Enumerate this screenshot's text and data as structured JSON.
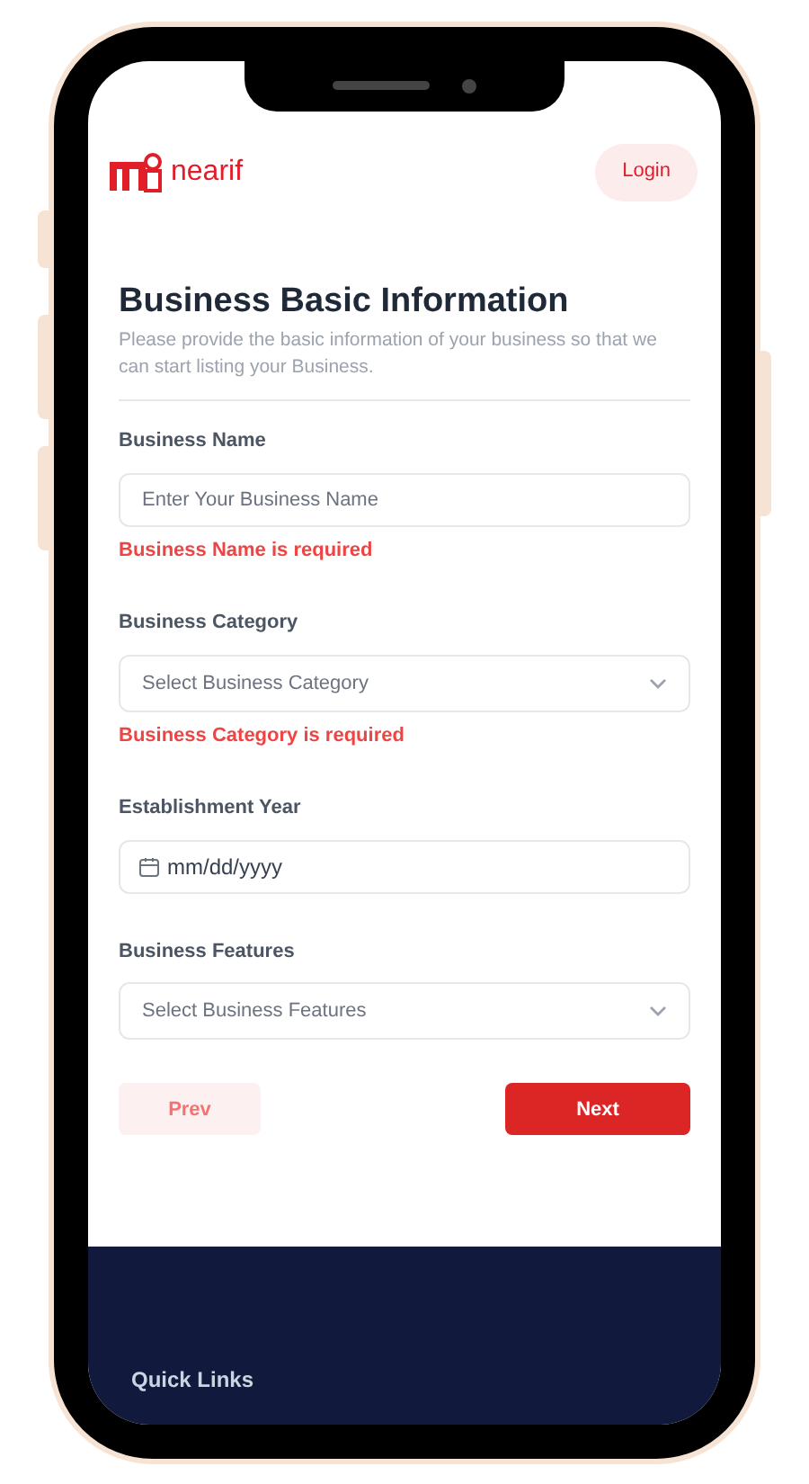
{
  "header": {
    "logo_text": "nearif",
    "login_button": "Login"
  },
  "form": {
    "title": "Business Basic Information",
    "description": "Please provide the basic information of your business so that we can start listing your Business.",
    "fields": [
      {
        "kind": "text",
        "label": "Business Name",
        "placeholder": "Enter Your Business Name",
        "error": "Business Name is required"
      },
      {
        "kind": "select",
        "label": "Business Category",
        "placeholder": "Select Business Category",
        "error": "Business Category is required"
      },
      {
        "kind": "date",
        "label": "Establishment Year",
        "placeholder": "mm/dd/yyyy"
      },
      {
        "kind": "select",
        "label": "Business Features",
        "placeholder": "Select Business Features"
      }
    ],
    "prev_button": "Prev",
    "next_button": "Next"
  },
  "footer": {
    "heading": "Quick Links"
  }
}
